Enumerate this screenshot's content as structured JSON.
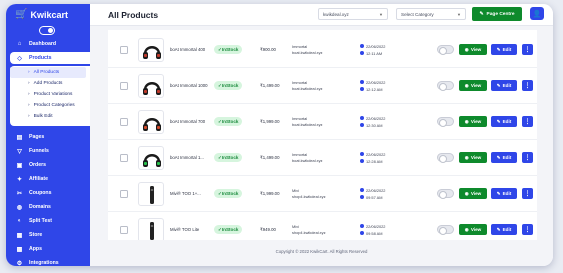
{
  "brand": {
    "name": "Kwikcart"
  },
  "sidebar": {
    "top_items": [
      {
        "label": "Dashboard",
        "icon": "home-icon",
        "active": false
      },
      {
        "label": "Products",
        "icon": "tag-icon",
        "active": true
      }
    ],
    "products_submenu": [
      {
        "label": "All Products",
        "active": true
      },
      {
        "label": "Add Products",
        "active": false
      },
      {
        "label": "Product Variations",
        "active": false
      },
      {
        "label": "Product Categories",
        "active": false
      },
      {
        "label": "Bulk Edit",
        "active": false
      }
    ],
    "items": [
      {
        "label": "Pages",
        "icon": "pages-icon"
      },
      {
        "label": "Funnels",
        "icon": "funnel-icon"
      },
      {
        "label": "Orders",
        "icon": "orders-icon"
      },
      {
        "label": "Affiliate",
        "icon": "affiliate-icon"
      },
      {
        "label": "Coupons",
        "icon": "coupon-icon"
      },
      {
        "label": "Domains",
        "icon": "globe-icon"
      },
      {
        "label": "Split Test",
        "icon": "split-test-icon"
      },
      {
        "label": "Store",
        "icon": "store-icon"
      },
      {
        "label": "Apps",
        "icon": "apps-icon"
      },
      {
        "label": "Integrations",
        "icon": "integrations-icon"
      }
    ]
  },
  "header": {
    "title": "All Products",
    "store_select": "kwikdeal.xyz",
    "category_select": "Select Category",
    "page_centre_label": "Page Centre"
  },
  "products": [
    {
      "name": "boAt Immortal 400",
      "status": "InStock",
      "price": "₹900.00",
      "store_line1": "Immortal",
      "store_line2": "boat.kwikdeal.xyz",
      "date": "22/06/2022",
      "time": "12:11 AM",
      "color": "#1b1b1b",
      "accent": "#c0392b"
    },
    {
      "name": "boAt Immortal 1000",
      "status": "InStock",
      "price": "₹1,499.00",
      "store_line1": "Immortal",
      "store_line2": "boat.kwikdeal.xyz",
      "date": "22/06/2022",
      "time": "12:12 AM",
      "color": "#1b1b1b",
      "accent": "#c0392b"
    },
    {
      "name": "boAt Immortal 700",
      "status": "InStock",
      "price": "₹1,999.00",
      "store_line1": "Immortal",
      "store_line2": "boat.kwikdeal.xyz",
      "date": "22/06/2022",
      "time": "12:30 AM",
      "color": "#1b1b1b",
      "accent": "#d14a2a"
    },
    {
      "name": "boAt Immortal 1...",
      "status": "InStock",
      "price": "₹1,499.00",
      "store_line1": "Immortal",
      "store_line2": "boat.kwikdeal.xyz",
      "date": "22/06/2022",
      "time": "12:28 AM",
      "color": "#1b1b1b",
      "accent": "#27c24c"
    },
    {
      "name": "Mivi® TOO 1+...",
      "status": "InStock",
      "price": "₹1,999.00",
      "store_line1": "Mivi",
      "store_line2": "shop4.kwikdeal.xyz",
      "date": "22/06/2022",
      "time": "09:57 AM",
      "color": "#222",
      "accent": "#444"
    },
    {
      "name": "Mivi® TOO Lite",
      "status": "InStock",
      "price": "₹949.00",
      "store_line1": "Mivi",
      "store_line2": "shop4.kwikdeal.xyz",
      "date": "22/06/2022",
      "time": "09:58 AM",
      "color": "#222",
      "accent": "#444"
    }
  ],
  "actions": {
    "view": "View",
    "edit": "Edit",
    "more": "⋮"
  },
  "footer": {
    "text": "Copyright © 2022 KwikCart. All Rights Reserved"
  }
}
